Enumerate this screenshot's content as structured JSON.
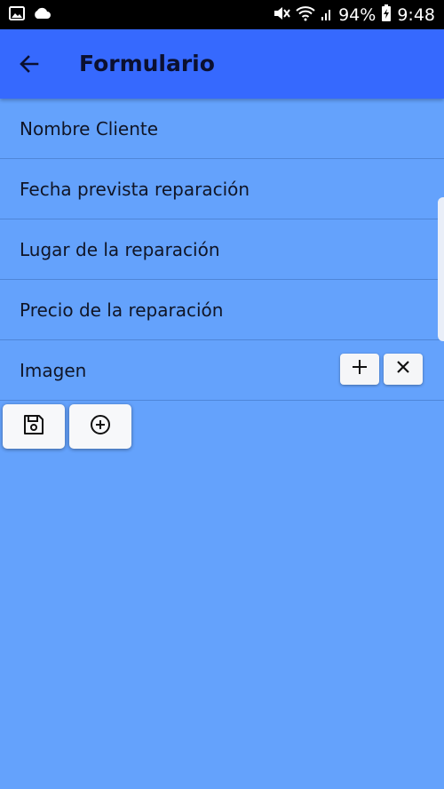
{
  "status_bar": {
    "battery": "94%",
    "time": "9:48",
    "left_icons": [
      "image-icon",
      "cloud-icon"
    ],
    "right_icons": [
      "mute-icon",
      "wifi-icon",
      "signal-icon",
      "battery-charging-icon"
    ]
  },
  "app_bar": {
    "title": "Formulario",
    "background": "#3669fe",
    "back_icon": "arrow-back-icon"
  },
  "form": {
    "fields": [
      {
        "label": "Nombre Cliente"
      },
      {
        "label": "Fecha prevista reparación"
      },
      {
        "label": "Lugar de la reparación"
      },
      {
        "label": "Precio de la reparación"
      }
    ],
    "image_row": {
      "label": "Imagen",
      "add_icon": "plus-icon",
      "remove_icon": "close-icon"
    }
  },
  "actions": {
    "save_icon": "save-icon",
    "add_icon": "add-circle-icon"
  },
  "colors": {
    "page_background": "#64a2fc",
    "divider": "#4f86d8"
  }
}
